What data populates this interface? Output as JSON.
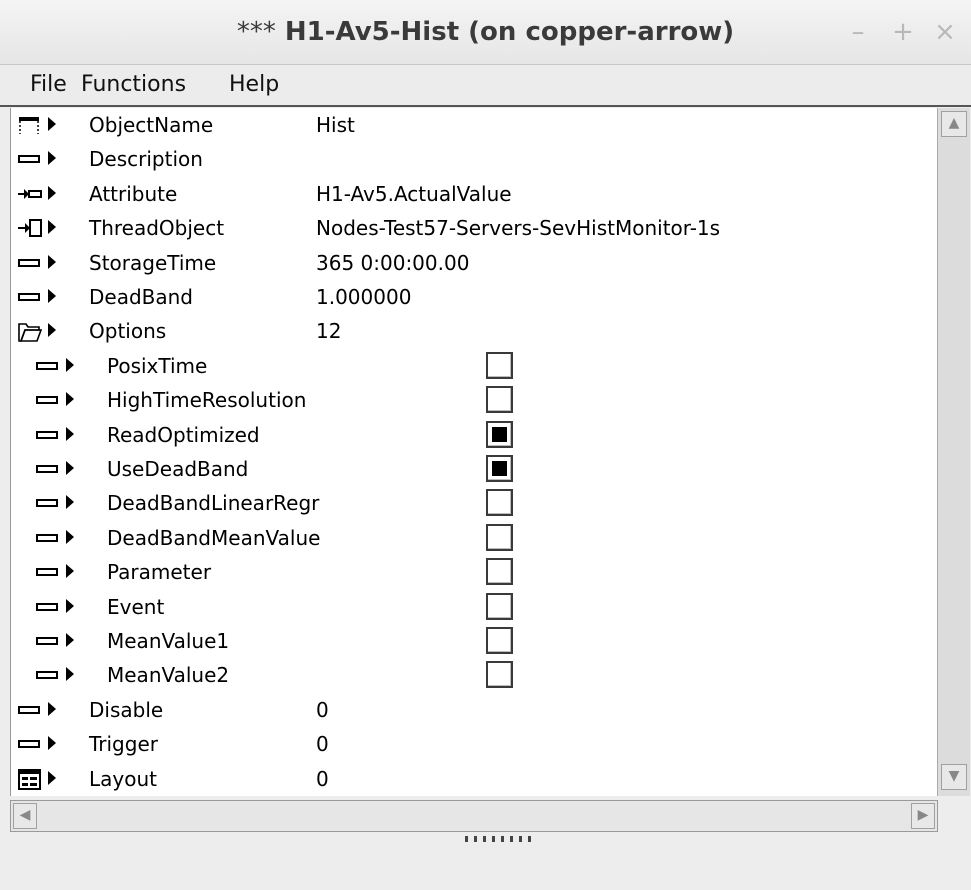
{
  "window": {
    "title_prefix": "***",
    "title": "H1-Av5-Hist (on copper-arrow)",
    "minimize": "–",
    "maximize": "+",
    "close": "×"
  },
  "menu": [
    "File",
    "Functions",
    "Help"
  ],
  "rows": [
    {
      "icon": "object-icon",
      "name": "ObjectName",
      "value": "Hist"
    },
    {
      "icon": "attribute-icon",
      "name": "Description",
      "value": ""
    },
    {
      "icon": "attribute-reference-icon",
      "name": "Attribute",
      "value": "H1-Av5.ActualValue"
    },
    {
      "icon": "object-reference-icon",
      "name": "ThreadObject",
      "value": "Nodes-Test57-Servers-SevHistMonitor-1s"
    },
    {
      "icon": "attribute-icon",
      "name": "StorageTime",
      "value": "365 0:00:00.00"
    },
    {
      "icon": "attribute-icon",
      "name": "DeadBand",
      "value": "1.000000"
    },
    {
      "icon": "folder-open-icon",
      "name": "Options",
      "value": "12"
    },
    {
      "icon": "attribute-icon",
      "name": "PosixTime",
      "checked": false,
      "indent": true
    },
    {
      "icon": "attribute-icon",
      "name": "HighTimeResolution",
      "checked": false,
      "indent": true
    },
    {
      "icon": "attribute-icon",
      "name": "ReadOptimized",
      "checked": true,
      "indent": true
    },
    {
      "icon": "attribute-icon",
      "name": "UseDeadBand",
      "checked": true,
      "indent": true
    },
    {
      "icon": "attribute-icon",
      "name": "DeadBandLinearRegr",
      "checked": false,
      "indent": true
    },
    {
      "icon": "attribute-icon",
      "name": "DeadBandMeanValue",
      "checked": false,
      "indent": true
    },
    {
      "icon": "attribute-icon",
      "name": "Parameter",
      "checked": false,
      "indent": true
    },
    {
      "icon": "attribute-icon",
      "name": "Event",
      "checked": false,
      "indent": true
    },
    {
      "icon": "attribute-icon",
      "name": "MeanValue1",
      "checked": false,
      "indent": true
    },
    {
      "icon": "attribute-icon",
      "name": "MeanValue2",
      "checked": false,
      "indent": true
    },
    {
      "icon": "attribute-icon",
      "name": "Disable",
      "value": "0"
    },
    {
      "icon": "attribute-icon",
      "name": "Trigger",
      "value": "0"
    },
    {
      "icon": "layout-icon",
      "name": "Layout",
      "value": "0"
    }
  ],
  "colors": {
    "title_text": "#3a3a3a",
    "background": "#ededed"
  }
}
